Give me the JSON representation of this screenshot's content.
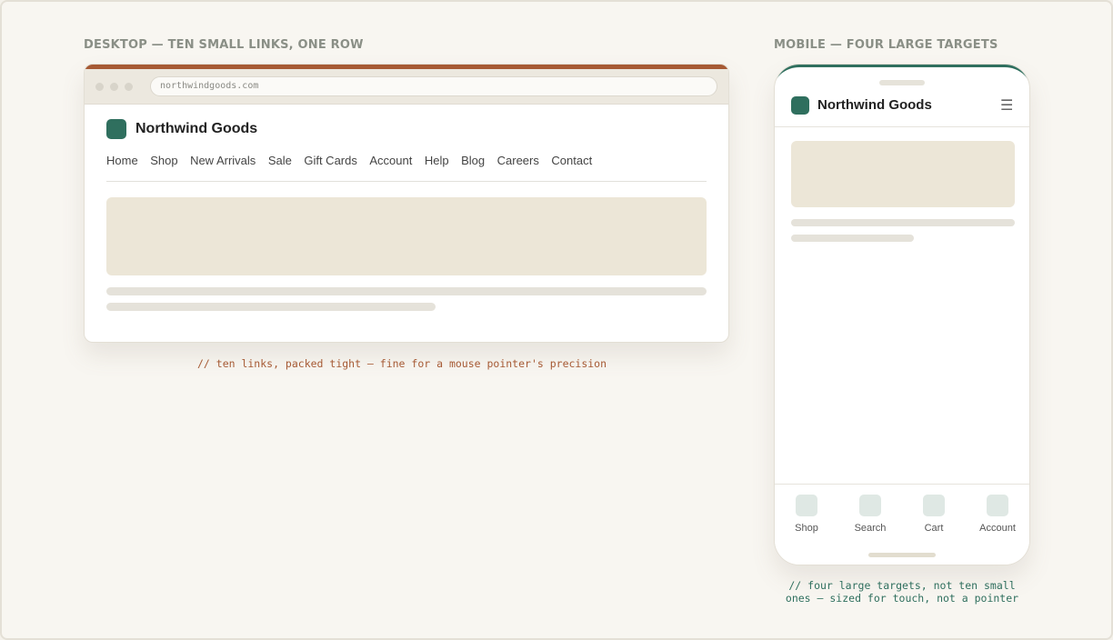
{
  "desktop": {
    "section_label": "DESKTOP — TEN SMALL LINKS, ONE ROW",
    "url": "northwindgoods.com",
    "brand": "Northwind Goods",
    "nav_links": [
      "Home",
      "Shop",
      "New Arrivals",
      "Sale",
      "Gift Cards",
      "Account",
      "Help",
      "Blog",
      "Careers",
      "Contact"
    ],
    "caption": "// ten links, packed tight — fine for a mouse pointer's precision"
  },
  "mobile": {
    "section_label": "MOBILE — FOUR LARGE TARGETS",
    "brand": "Northwind Goods",
    "menu_icon": "☰",
    "tabs": [
      {
        "label": "Shop",
        "icon": "shop-icon"
      },
      {
        "label": "Search",
        "icon": "search-icon"
      },
      {
        "label": "Cart",
        "icon": "cart-icon"
      },
      {
        "label": "Account",
        "icon": "account-icon"
      }
    ],
    "caption_line1": "// four large targets, not ten small",
    "caption_line2": "ones — sized for touch, not a pointer"
  },
  "colors": {
    "brand_green": "#2f6f5e",
    "desktop_accent": "#a65a34",
    "placeholder": "#ece6d7",
    "desktop_caption": "#a65a34",
    "mobile_caption": "#2f6f5e"
  }
}
